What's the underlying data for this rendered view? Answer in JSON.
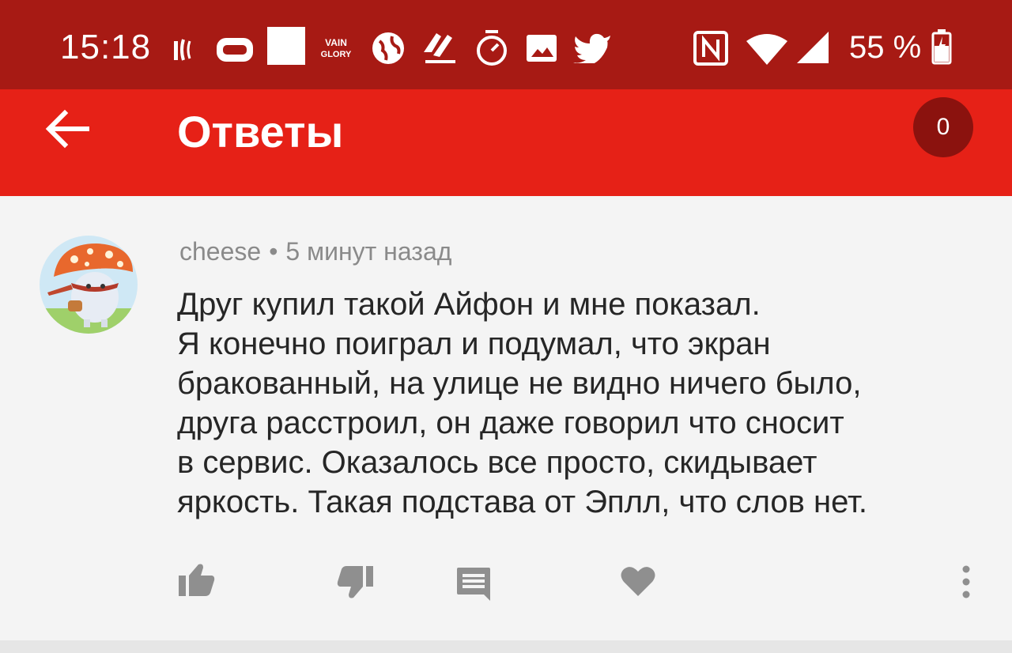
{
  "status_bar": {
    "time": "15:18",
    "battery": "55 %",
    "icons": [
      "signal-strength-icon",
      "game-controller-icon",
      "notification-square-icon",
      "vainglory-icon",
      "globe-icon",
      "game-icon",
      "stopwatch-icon",
      "image-icon",
      "twitter-icon",
      "nfc-icon",
      "wifi-icon",
      "cell-signal-icon",
      "battery-icon"
    ],
    "vainglory_label_1": "VAIN",
    "vainglory_label_2": "GLORY"
  },
  "app_bar": {
    "title": "Ответы",
    "counter": "0",
    "background_color": "#e62117",
    "status_color": "#a71a14"
  },
  "comment": {
    "author": "cheese",
    "separator": "•",
    "time_ago": "5 минут назад",
    "lines": [
      "Друг купил такой Айфон и мне показал.",
      "Я конечно поиграл и подумал, что экран",
      "бракованный, на улице не видно ничего было,",
      "друга расстроил, он даже говорил что сносит",
      "в сервис. Оказалось все просто, скидывает",
      "яркость. Такая подстава от Эплл, что слов нет."
    ]
  },
  "actions": {
    "icons": [
      "like-icon",
      "dislike-icon",
      "reply-icon",
      "heart-icon",
      "more-icon"
    ]
  }
}
